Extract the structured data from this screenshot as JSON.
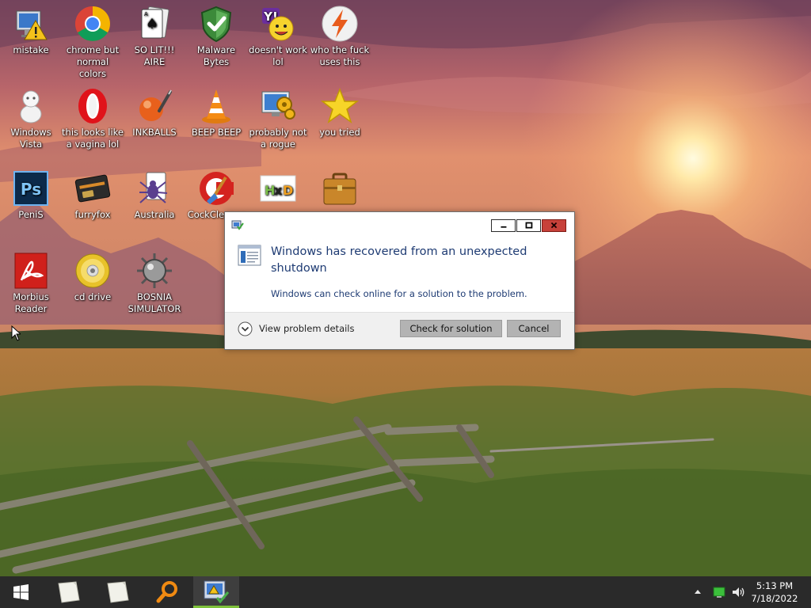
{
  "desktop": {
    "icons": [
      {
        "label": "mistake",
        "icon": "computer-warning-icon"
      },
      {
        "label": "chrome but normal colors",
        "icon": "chrome-icon"
      },
      {
        "label": "SO LIT!!! AIRE",
        "icon": "solitaire-card-icon"
      },
      {
        "label": "Malware Bytes",
        "icon": "shield-check-icon"
      },
      {
        "label": "doesn't work lol",
        "icon": "yahoo-messenger-icon"
      },
      {
        "label": "who the fuck uses this",
        "icon": "lightning-bolt-icon"
      },
      {
        "label": "Windows Vista",
        "icon": "vista-figure-icon"
      },
      {
        "label": "this looks like a vagina lol",
        "icon": "opera-icon"
      },
      {
        "label": "INKBALLS",
        "icon": "inkball-icon"
      },
      {
        "label": "BEEP BEEP",
        "icon": "vlc-cone-icon"
      },
      {
        "label": "probably not a rogue",
        "icon": "monitor-gears-icon"
      },
      {
        "label": "you tried",
        "icon": "star-icon"
      },
      {
        "label": "PeniS",
        "icon": "photoshop-icon"
      },
      {
        "label": "furryfox",
        "icon": "firefox-card-icon"
      },
      {
        "label": "Australia",
        "icon": "spider-solitaire-icon"
      },
      {
        "label": "CockCleaner",
        "icon": "ccleaner-icon"
      },
      {
        "label": "",
        "icon": "hxd-icon"
      },
      {
        "label": "",
        "icon": "briefcase-icon"
      },
      {
        "label": "Morbius Reader",
        "icon": "acrobat-icon"
      },
      {
        "label": "cd drive",
        "icon": "cd-disc-icon"
      },
      {
        "label": "BOSNIA SIMULATOR",
        "icon": "mine-icon"
      }
    ]
  },
  "dialog": {
    "heading": "Windows has recovered from an unexpected shutdown",
    "subtext": "Windows can check online for a solution to the problem.",
    "details_label": "View problem details",
    "check_button": "Check for solution",
    "cancel_button": "Cancel",
    "icon": "problem-report-icon"
  },
  "taskbar": {
    "items": [
      "windows-logo-icon",
      "sticky-note-icon",
      "sticky-note-icon",
      "magnifier-icon",
      "problem-reports-app-icon"
    ],
    "tray": [
      "show-hidden-icons-arrow",
      "network-icon",
      "volume-icon"
    ],
    "clock": {
      "time": "5:13 PM",
      "date": "7/18/2022"
    }
  },
  "colors": {
    "dialog_text": "#1e3b73",
    "close_button": "#c7413a",
    "taskbar": "#2a2a2a",
    "active_indicator": "#7ec23b"
  }
}
